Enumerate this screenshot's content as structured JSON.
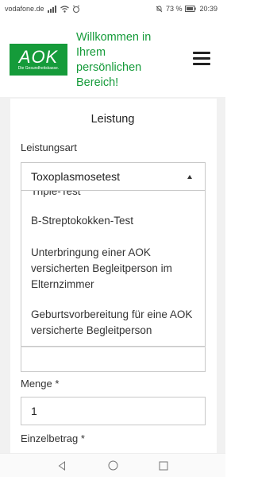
{
  "status_bar": {
    "carrier": "vodafone.de",
    "battery": "73 %",
    "time": "20:39"
  },
  "header": {
    "logo_text": "AOK",
    "logo_subtext": "Die Gesundheitskasse.",
    "welcome_text": "Willkommen in Ihrem persönlichen Bereich!"
  },
  "form": {
    "section_title": "Leistung",
    "leistungsart_label": "Leistungsart",
    "leistungsart_value": "Toxoplasmosetest",
    "dropdown": {
      "partial_item": "Triple-Test",
      "items": [
        "B-Streptokokken-Test",
        "Unterbringung einer AOK versicherten Begleitperson im Elternzimmer",
        "Geburtsvorbereitung für eine AOK versicherte Begleitperson"
      ]
    },
    "menge_label": "Menge *",
    "menge_value": "1",
    "einzelbetrag_label": "Einzelbetrag *"
  },
  "colors": {
    "brand_green": "#159b3a"
  }
}
